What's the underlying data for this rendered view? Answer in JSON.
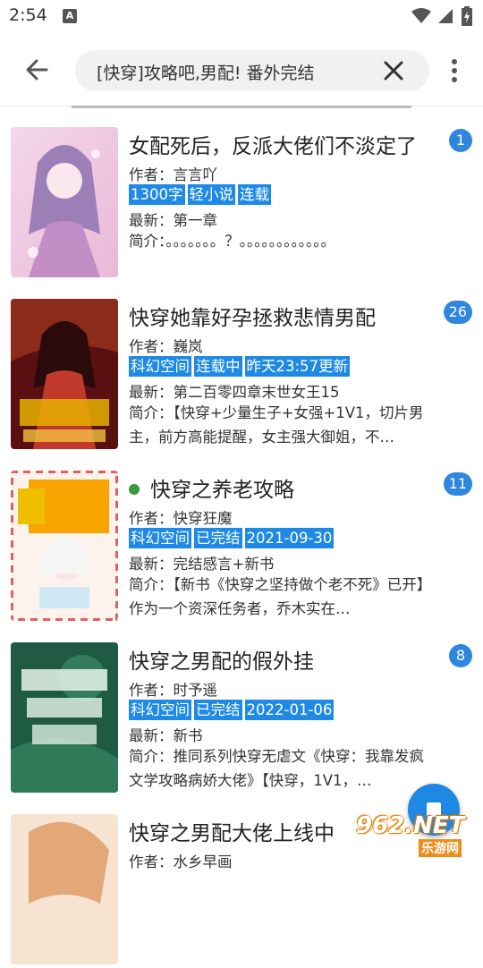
{
  "status": {
    "time": "2:54",
    "notif_letter": "A"
  },
  "search": {
    "query": "[快穿]攻略吧,男配! 番外完结"
  },
  "books": [
    {
      "title": "女配死后，反派大佬们不淡定了",
      "badge": "1",
      "author": "作者：言言吖",
      "tags": [
        "1300字",
        "轻小说",
        "连载"
      ],
      "latest": "最新：第一章",
      "intro": "简介：。。。。。。。？。。。。。。。。。。。。",
      "dot": false
    },
    {
      "title": "快穿她靠好孕拯救悲情男配",
      "badge": "26",
      "author": "作者：巍岚",
      "tags": [
        "科幻空间",
        "连载中",
        "昨天23:57更新"
      ],
      "latest": "最新：第二百零四章末世女王15",
      "intro": "简介：【快穿+少量生子+女强+1V1，切片男主，前方高能提醒，女主强大御姐，不…",
      "dot": false
    },
    {
      "title": "快穿之养老攻略",
      "badge": "11",
      "author": "作者：快穿狂魔",
      "tags": [
        "科幻空间",
        "已完结",
        "2021-09-30"
      ],
      "latest": "最新：完结感言+新书",
      "intro": "简介：【新书《快穿之坚持做个老不死》已开】作为一个资深任务者，乔木实在…",
      "dot": true
    },
    {
      "title": "快穿之男配的假外挂",
      "badge": "8",
      "author": "作者：时予遥",
      "tags": [
        "科幻空间",
        "已完结",
        "2022-01-06"
      ],
      "latest": "最新：新书",
      "intro": "简介：推同系列快穿无虐文《快穿：我靠发疯文学攻略病娇大佬》【快穿，1V1，…",
      "dot": false
    },
    {
      "title": "快穿之男配大佬上线中",
      "badge": "",
      "author": "作者：水乡早画",
      "tags": [],
      "latest": "",
      "intro": "",
      "dot": false
    }
  ],
  "watermark": {
    "main": "962.NET",
    "sub": "乐游网"
  },
  "colors": {
    "accent": "#1f8ae6",
    "badge": "#2e86de",
    "dot": "#3a9a3a"
  }
}
